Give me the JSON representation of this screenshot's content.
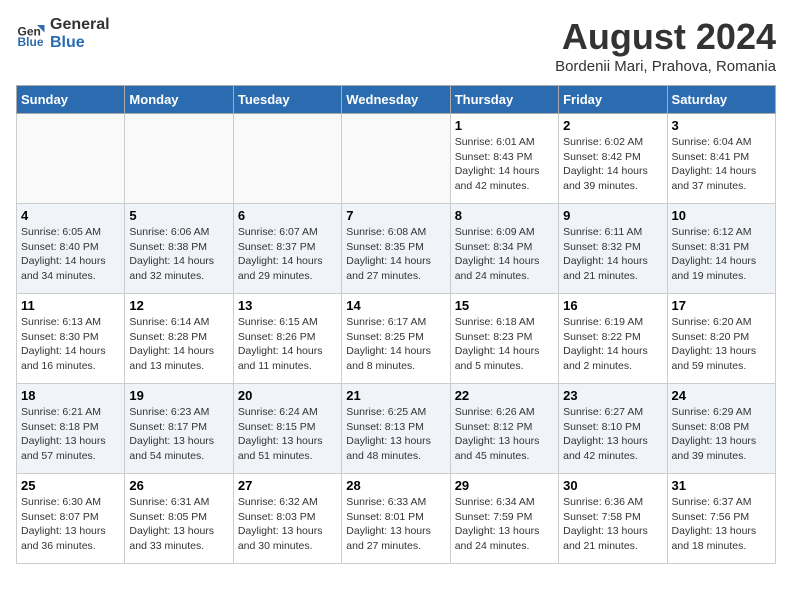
{
  "header": {
    "logo_line1": "General",
    "logo_line2": "Blue",
    "month_year": "August 2024",
    "location": "Bordenii Mari, Prahova, Romania"
  },
  "weekdays": [
    "Sunday",
    "Monday",
    "Tuesday",
    "Wednesday",
    "Thursday",
    "Friday",
    "Saturday"
  ],
  "weeks": [
    [
      {
        "day": "",
        "info": ""
      },
      {
        "day": "",
        "info": ""
      },
      {
        "day": "",
        "info": ""
      },
      {
        "day": "",
        "info": ""
      },
      {
        "day": "1",
        "info": "Sunrise: 6:01 AM\nSunset: 8:43 PM\nDaylight: 14 hours\nand 42 minutes."
      },
      {
        "day": "2",
        "info": "Sunrise: 6:02 AM\nSunset: 8:42 PM\nDaylight: 14 hours\nand 39 minutes."
      },
      {
        "day": "3",
        "info": "Sunrise: 6:04 AM\nSunset: 8:41 PM\nDaylight: 14 hours\nand 37 minutes."
      }
    ],
    [
      {
        "day": "4",
        "info": "Sunrise: 6:05 AM\nSunset: 8:40 PM\nDaylight: 14 hours\nand 34 minutes."
      },
      {
        "day": "5",
        "info": "Sunrise: 6:06 AM\nSunset: 8:38 PM\nDaylight: 14 hours\nand 32 minutes."
      },
      {
        "day": "6",
        "info": "Sunrise: 6:07 AM\nSunset: 8:37 PM\nDaylight: 14 hours\nand 29 minutes."
      },
      {
        "day": "7",
        "info": "Sunrise: 6:08 AM\nSunset: 8:35 PM\nDaylight: 14 hours\nand 27 minutes."
      },
      {
        "day": "8",
        "info": "Sunrise: 6:09 AM\nSunset: 8:34 PM\nDaylight: 14 hours\nand 24 minutes."
      },
      {
        "day": "9",
        "info": "Sunrise: 6:11 AM\nSunset: 8:32 PM\nDaylight: 14 hours\nand 21 minutes."
      },
      {
        "day": "10",
        "info": "Sunrise: 6:12 AM\nSunset: 8:31 PM\nDaylight: 14 hours\nand 19 minutes."
      }
    ],
    [
      {
        "day": "11",
        "info": "Sunrise: 6:13 AM\nSunset: 8:30 PM\nDaylight: 14 hours\nand 16 minutes."
      },
      {
        "day": "12",
        "info": "Sunrise: 6:14 AM\nSunset: 8:28 PM\nDaylight: 14 hours\nand 13 minutes."
      },
      {
        "day": "13",
        "info": "Sunrise: 6:15 AM\nSunset: 8:26 PM\nDaylight: 14 hours\nand 11 minutes."
      },
      {
        "day": "14",
        "info": "Sunrise: 6:17 AM\nSunset: 8:25 PM\nDaylight: 14 hours\nand 8 minutes."
      },
      {
        "day": "15",
        "info": "Sunrise: 6:18 AM\nSunset: 8:23 PM\nDaylight: 14 hours\nand 5 minutes."
      },
      {
        "day": "16",
        "info": "Sunrise: 6:19 AM\nSunset: 8:22 PM\nDaylight: 14 hours\nand 2 minutes."
      },
      {
        "day": "17",
        "info": "Sunrise: 6:20 AM\nSunset: 8:20 PM\nDaylight: 13 hours\nand 59 minutes."
      }
    ],
    [
      {
        "day": "18",
        "info": "Sunrise: 6:21 AM\nSunset: 8:18 PM\nDaylight: 13 hours\nand 57 minutes."
      },
      {
        "day": "19",
        "info": "Sunrise: 6:23 AM\nSunset: 8:17 PM\nDaylight: 13 hours\nand 54 minutes."
      },
      {
        "day": "20",
        "info": "Sunrise: 6:24 AM\nSunset: 8:15 PM\nDaylight: 13 hours\nand 51 minutes."
      },
      {
        "day": "21",
        "info": "Sunrise: 6:25 AM\nSunset: 8:13 PM\nDaylight: 13 hours\nand 48 minutes."
      },
      {
        "day": "22",
        "info": "Sunrise: 6:26 AM\nSunset: 8:12 PM\nDaylight: 13 hours\nand 45 minutes."
      },
      {
        "day": "23",
        "info": "Sunrise: 6:27 AM\nSunset: 8:10 PM\nDaylight: 13 hours\nand 42 minutes."
      },
      {
        "day": "24",
        "info": "Sunrise: 6:29 AM\nSunset: 8:08 PM\nDaylight: 13 hours\nand 39 minutes."
      }
    ],
    [
      {
        "day": "25",
        "info": "Sunrise: 6:30 AM\nSunset: 8:07 PM\nDaylight: 13 hours\nand 36 minutes."
      },
      {
        "day": "26",
        "info": "Sunrise: 6:31 AM\nSunset: 8:05 PM\nDaylight: 13 hours\nand 33 minutes."
      },
      {
        "day": "27",
        "info": "Sunrise: 6:32 AM\nSunset: 8:03 PM\nDaylight: 13 hours\nand 30 minutes."
      },
      {
        "day": "28",
        "info": "Sunrise: 6:33 AM\nSunset: 8:01 PM\nDaylight: 13 hours\nand 27 minutes."
      },
      {
        "day": "29",
        "info": "Sunrise: 6:34 AM\nSunset: 7:59 PM\nDaylight: 13 hours\nand 24 minutes."
      },
      {
        "day": "30",
        "info": "Sunrise: 6:36 AM\nSunset: 7:58 PM\nDaylight: 13 hours\nand 21 minutes."
      },
      {
        "day": "31",
        "info": "Sunrise: 6:37 AM\nSunset: 7:56 PM\nDaylight: 13 hours\nand 18 minutes."
      }
    ]
  ]
}
